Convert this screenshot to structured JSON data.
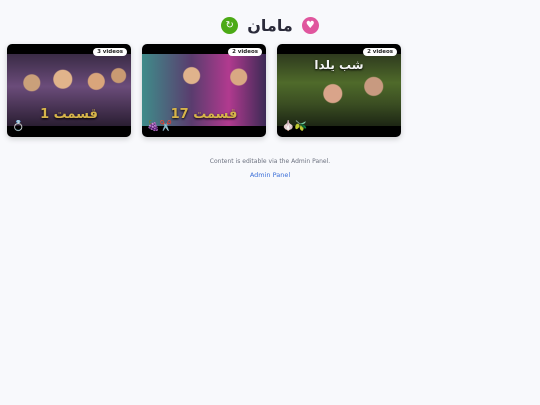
{
  "header": {
    "title": "مامان",
    "left_icon": "refresh-icon",
    "right_icon": "heart-icon",
    "colors": {
      "left_badge": "#4caa16",
      "right_badge": "#e0569e"
    }
  },
  "cards": [
    {
      "count_label": "2 videos",
      "overlay_text": "شب يلدا",
      "emoji": "🧄🫒",
      "thumb_theme": "garden"
    },
    {
      "count_label": "2 videos",
      "overlay_text": "قسمت 17",
      "emoji": "🍇✂️",
      "thumb_theme": "purple"
    },
    {
      "count_label": "3 videos",
      "overlay_text": "قسمت 1",
      "emoji": "💍",
      "thumb_theme": "group"
    }
  ],
  "footer": {
    "note": "Content is editable via the Admin Panel.",
    "link_label": "Admin Panel"
  }
}
